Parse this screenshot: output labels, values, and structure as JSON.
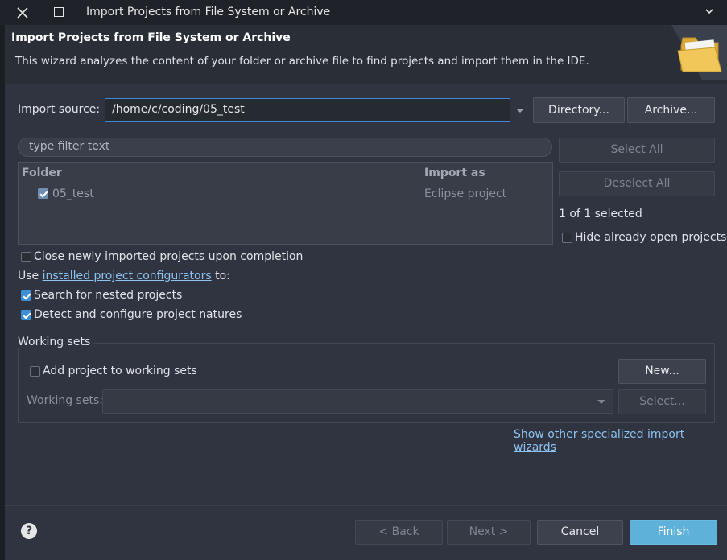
{
  "window": {
    "title": "Import Projects from File System or Archive"
  },
  "header": {
    "title": "Import Projects from File System or Archive",
    "description": "This wizard analyzes the content of your folder or archive file to find projects and import them in the IDE."
  },
  "source": {
    "label": "Import source:",
    "value": "/home/c/coding/05_test",
    "directory_button": "Directory...",
    "archive_button": "Archive..."
  },
  "filter": {
    "placeholder": "type filter text"
  },
  "table": {
    "headers": [
      "Folder",
      "Import as"
    ],
    "rows": [
      {
        "folder": "05_test",
        "import_as": "Eclipse project",
        "checked": true
      }
    ]
  },
  "side": {
    "select_all": "Select All",
    "deselect_all": "Deselect All",
    "selected_count": "1 of 1 selected",
    "hide_open": "Hide already open projects"
  },
  "options": {
    "close_imported": "Close newly imported projects upon completion",
    "use_prefix": "Use",
    "use_link": "installed project configurators",
    "use_suffix": "to:",
    "nested": "Search for nested projects",
    "natures": "Detect and configure project natures"
  },
  "working_sets": {
    "group_label": "Working sets",
    "add_label": "Add project to working sets",
    "new_button": "New...",
    "sets_label": "Working sets:",
    "select_button": "Select..."
  },
  "other_wizards_link": "Show other specialized import wizards",
  "footer": {
    "help": "?",
    "back": "< Back",
    "next": "Next >",
    "cancel": "Cancel",
    "finish": "Finish"
  },
  "icons": {
    "close": "close-icon",
    "maximize": "maximize-icon",
    "menu": "chevron-down-icon",
    "banner": "folder-icon",
    "help": "help-icon"
  },
  "colors": {
    "accent": "#3d8fd6",
    "finish": "#5eb1d8",
    "link": "#8dc3f0"
  }
}
